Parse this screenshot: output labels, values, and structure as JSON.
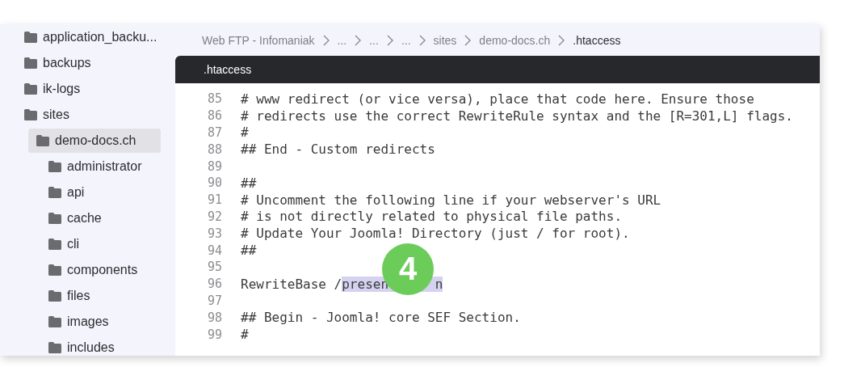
{
  "sidebar": {
    "items": [
      {
        "label": "application_backu...",
        "selected": false
      },
      {
        "label": "backups",
        "selected": false
      },
      {
        "label": "ik-logs",
        "selected": false
      },
      {
        "label": "sites",
        "selected": false,
        "children": [
          {
            "label": "demo-docs.ch",
            "selected": true,
            "children": [
              {
                "label": "administrator",
                "selected": false
              },
              {
                "label": "api",
                "selected": false
              },
              {
                "label": "cache",
                "selected": false
              },
              {
                "label": "cli",
                "selected": false
              },
              {
                "label": "components",
                "selected": false
              },
              {
                "label": "files",
                "selected": false
              },
              {
                "label": "images",
                "selected": false
              },
              {
                "label": "includes",
                "selected": false
              }
            ]
          }
        ]
      }
    ]
  },
  "breadcrumb": [
    "Web FTP - Infomaniak",
    "...",
    "...",
    "...",
    "sites",
    "demo-docs.ch",
    ".htaccess"
  ],
  "tabs": [
    {
      "label": ".htaccess",
      "selected": true
    }
  ],
  "code": [
    {
      "number": "85",
      "text": "# www redirect (or vice versa), place that code here. Ensure those"
    },
    {
      "number": "86",
      "text": "# redirects use the correct RewriteRule syntax and the [R=301,L] flags."
    },
    {
      "number": "87",
      "text": "#"
    },
    {
      "number": "88",
      "text": "## End - Custom redirects"
    },
    {
      "number": "89"
    },
    {
      "number": "90",
      "text": "##"
    },
    {
      "number": "91",
      "text": "# Uncomment the following line if your webserver's URL"
    },
    {
      "number": "92",
      "text": "# is not directly related to physical file paths."
    },
    {
      "number": "93",
      "text": "# Update Your Joomla! Directory (just / for root)."
    },
    {
      "number": "94",
      "text": "##"
    },
    {
      "number": "95"
    },
    {
      "number": "96",
      "text": "RewriteBase /",
      "selection": [
        "presen",
        "n"
      ],
      "badge": "4"
    },
    {
      "number": "97"
    },
    {
      "number": "98",
      "text": "## Begin - Joomla! core SEF Section."
    },
    {
      "number": "99",
      "text": "#"
    }
  ]
}
